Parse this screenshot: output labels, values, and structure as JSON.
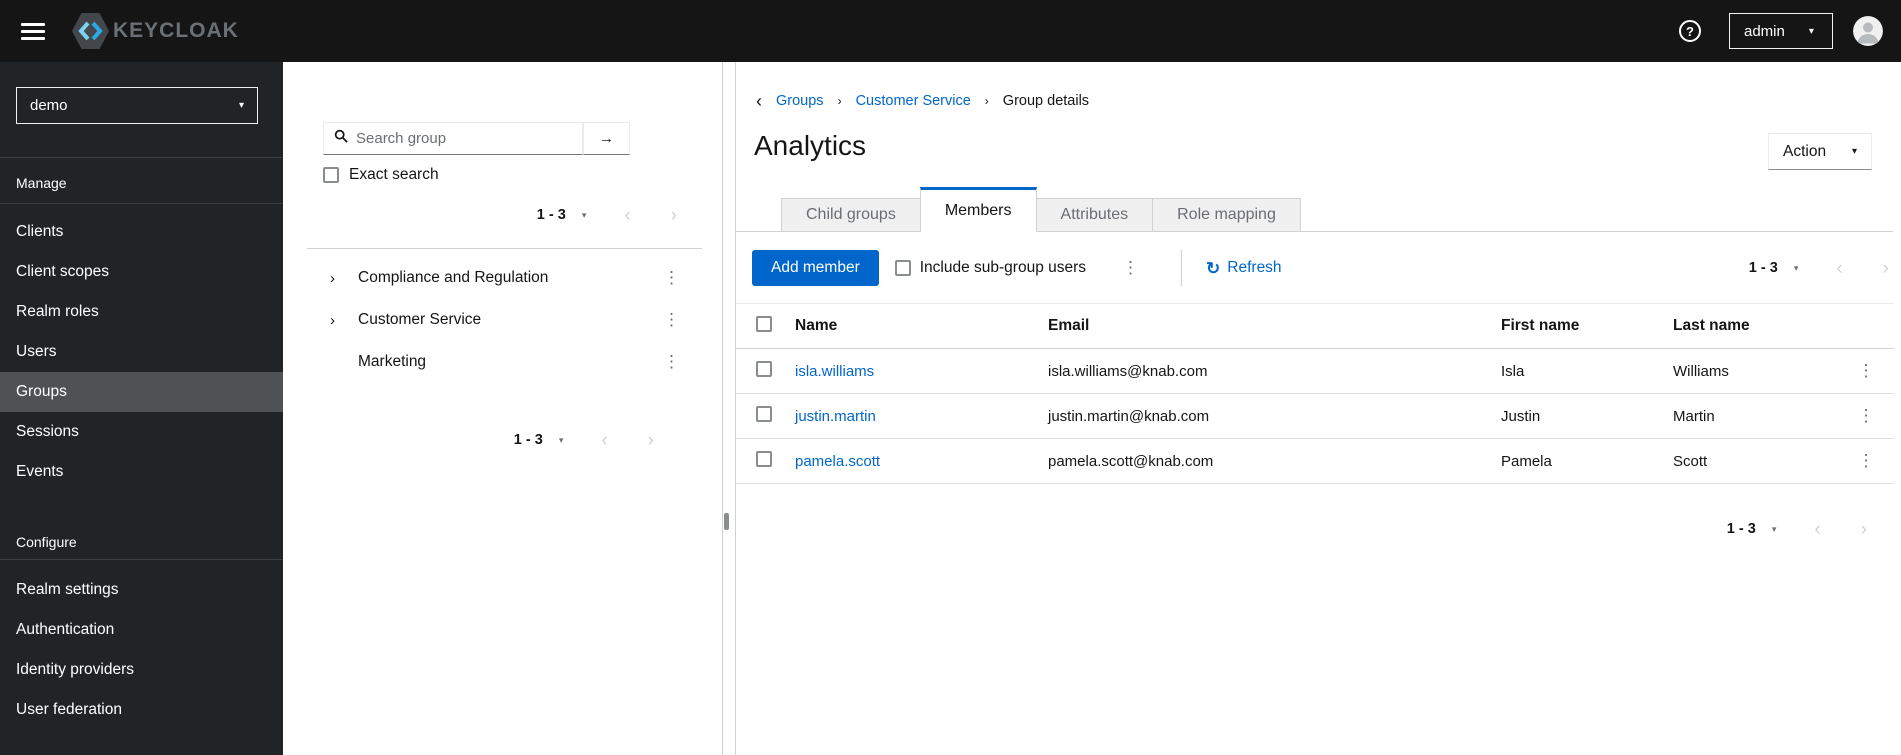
{
  "masthead": {
    "brand": "KEYCLOAK",
    "user": "admin"
  },
  "icons": {
    "help": "?",
    "caret_down": "▾",
    "chevron_left": "‹",
    "chevron_right": "›",
    "breadcrumb_sep": "›",
    "back": "‹",
    "kebab": "⋮",
    "arrow_right": "→",
    "refresh": "↻",
    "tree_expand": "›"
  },
  "colors": {
    "primary": "#0066cc",
    "link": "#0066cc",
    "masthead_bg": "#151515",
    "sidebar_bg": "#212427",
    "sidebar_active_bg": "#4f5255",
    "tab_inactive_bg": "#f0f0f0",
    "border": "#d2d2d2",
    "muted": "#6a6e73"
  },
  "sidebar": {
    "realm": "demo",
    "sections": [
      {
        "label": "Manage",
        "items": [
          {
            "label": "Clients"
          },
          {
            "label": "Client scopes"
          },
          {
            "label": "Realm roles"
          },
          {
            "label": "Users"
          },
          {
            "label": "Groups",
            "active": true
          },
          {
            "label": "Sessions"
          },
          {
            "label": "Events"
          }
        ]
      },
      {
        "label": "Configure",
        "items": [
          {
            "label": "Realm settings"
          },
          {
            "label": "Authentication"
          },
          {
            "label": "Identity providers"
          },
          {
            "label": "User federation"
          }
        ]
      }
    ]
  },
  "groups_panel": {
    "search_placeholder": "Search group",
    "exact_search_label": "Exact search",
    "pagination_top_range": "1 - 3",
    "pagination_bottom_range": "1 - 3",
    "tree": [
      {
        "label": "Compliance and Regulation",
        "expandable": true
      },
      {
        "label": "Customer Service",
        "expandable": true
      },
      {
        "label": "Marketing",
        "expandable": false
      }
    ]
  },
  "main": {
    "breadcrumb": [
      "Groups",
      "Customer Service",
      "Group details"
    ],
    "title": "Analytics",
    "action_label": "Action",
    "tabs": [
      {
        "label": "Child groups"
      },
      {
        "label": "Members",
        "active": true
      },
      {
        "label": "Attributes"
      },
      {
        "label": "Role mapping"
      }
    ],
    "toolbar": {
      "add_member_label": "Add member",
      "include_subgroups_label": "Include sub-group users",
      "refresh_label": "Refresh",
      "pagination_range": "1 - 3"
    },
    "table": {
      "columns": [
        "Name",
        "Email",
        "First name",
        "Last name"
      ],
      "rows": [
        {
          "name": "isla.williams",
          "email": "isla.williams@knab.com",
          "first": "Isla",
          "last": "Williams"
        },
        {
          "name": "justin.martin",
          "email": "justin.martin@knab.com",
          "first": "Justin",
          "last": "Martin"
        },
        {
          "name": "pamela.scott",
          "email": "pamela.scott@knab.com",
          "first": "Pamela",
          "last": "Scott"
        }
      ]
    },
    "bottom_pagination_range": "1 - 3"
  }
}
